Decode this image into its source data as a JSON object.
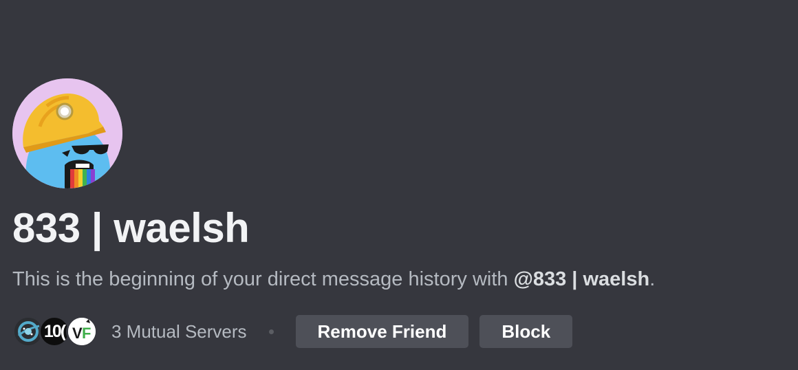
{
  "profile": {
    "display_name": "833 | waelsh",
    "avatar_icon": "miner-helmet-avatar",
    "avatar_bg": "#e7c4ef"
  },
  "intro": {
    "prefix": "This is the beginning of your direct message history with ",
    "mention": "@833 | waelsh",
    "suffix": "."
  },
  "mutual": {
    "servers": [
      {
        "icon": "planet-logo-icon",
        "label": ""
      },
      {
        "icon": "text-logo-icon",
        "label": "10("
      },
      {
        "icon": "vf-logo-icon",
        "label": "VF"
      }
    ],
    "label": "3 Mutual Servers"
  },
  "actions": {
    "remove_friend": "Remove Friend",
    "block": "Block"
  },
  "colors": {
    "background": "#36373e",
    "button": "#4e5058",
    "text_muted": "#b5bac1",
    "heading": "#f2f3f5"
  }
}
